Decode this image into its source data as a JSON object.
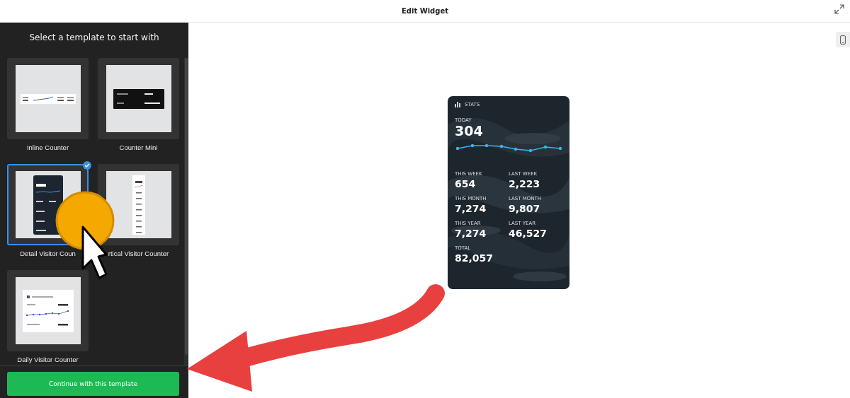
{
  "window": {
    "title": "Edit Widget"
  },
  "sidebar": {
    "heading": "Select a template to start with",
    "templates": [
      {
        "label": "Inline Counter",
        "kind": "inline",
        "selected": false
      },
      {
        "label": "Counter Mini",
        "kind": "mini",
        "selected": false
      },
      {
        "label": "Detail Visitor Coun",
        "kind": "detail",
        "selected": true
      },
      {
        "label": "rtical Visitor Counter",
        "kind": "vertical",
        "selected": false
      },
      {
        "label": "Daily Visitor Counter",
        "kind": "daily",
        "selected": false
      }
    ],
    "button": "Continue with this template"
  },
  "widget": {
    "title": "STATS",
    "today": {
      "label": "TODAY",
      "value": "304"
    },
    "stats": [
      {
        "label": "THIS WEEK",
        "value": "654"
      },
      {
        "label": "LAST WEEK",
        "value": "2,223"
      },
      {
        "label": "THIS MONTH",
        "value": "7,274"
      },
      {
        "label": "LAST MONTH",
        "value": "9,807"
      },
      {
        "label": "THIS YEAR",
        "value": "7,274"
      },
      {
        "label": "LAST YEAR",
        "value": "46,527"
      }
    ],
    "total": {
      "label": "TOTAL",
      "value": "82,057"
    }
  }
}
